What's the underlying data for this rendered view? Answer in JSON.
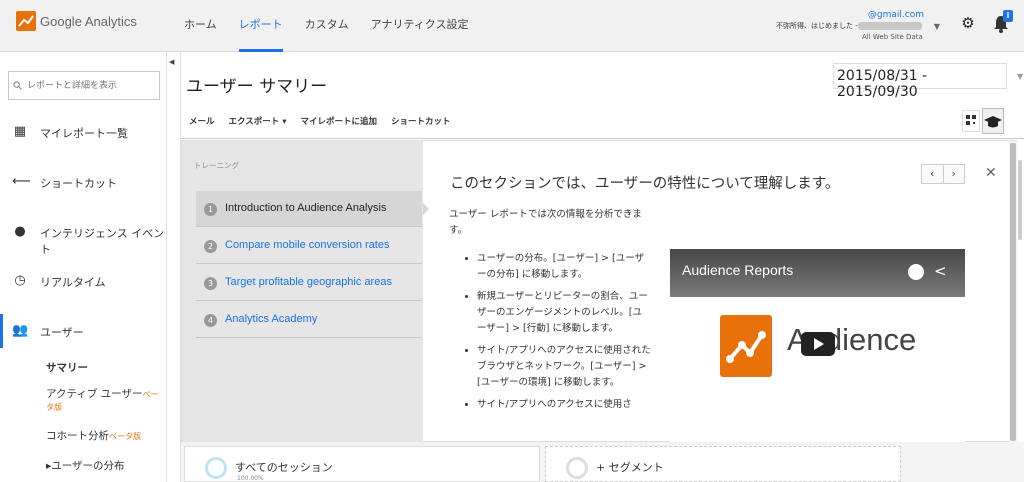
{
  "header": {
    "logo_text": "Google Analytics",
    "nav": [
      "ホーム",
      "レポート",
      "カスタム",
      "アナリティクス設定"
    ],
    "nav_active_index": 1,
    "account": {
      "email_suffix": "@gmail.com",
      "greeting": "不awaiting、はじめました -",
      "property": "All Web Site Data"
    },
    "notification_badge": "i",
    "accent_color": "#1a73e8"
  },
  "sidebar": {
    "search_placeholder": "レポートと詳細を表示",
    "items": [
      {
        "label": "マイレポート一覧",
        "icon": "grid-icon"
      },
      {
        "label": "ショートカット",
        "icon": "shortcut-arrow-icon"
      },
      {
        "label": "インテリジェンス イベント",
        "icon": "lightbulb-icon"
      },
      {
        "label": "リアルタイム",
        "icon": "clock-icon"
      },
      {
        "label": "ユーザー",
        "icon": "users-icon"
      }
    ],
    "sub_items": [
      {
        "label": "サマリー",
        "beta": ""
      },
      {
        "label": "アクティブ ユーザー",
        "beta": "ベータ版"
      },
      {
        "label": "コホート分析",
        "beta": "ベータ版"
      },
      {
        "label": "▸ユーザーの分布",
        "beta": ""
      }
    ]
  },
  "main": {
    "title": "ユーザー サマリー",
    "date_range": "2015/08/31 - 2015/09/30",
    "toolbar": [
      "メール",
      "エクスポート ▾",
      "マイレポートに追加",
      "ショートカット"
    ]
  },
  "training": {
    "label": "トレーニング",
    "lessons": [
      {
        "num": "1",
        "label": "Introduction to Audience Analysis"
      },
      {
        "num": "2",
        "label": "Compare mobile conversion rates"
      },
      {
        "num": "3",
        "label": "Target profitable geographic areas"
      },
      {
        "num": "4",
        "label": "Analytics Academy"
      }
    ],
    "heading": "このセクションでは、ユーザーの特性について理解します。",
    "intro": "ユーザー レポートでは次の情報を分析できます。",
    "bullets": [
      "ユーザーの分布。[ユーザー] > [ユーザーの分布] に移動します。",
      "新規ユーザーとリピーターの割合、ユーザーのエンゲージメントのレベル。[ユーザー] > [行動] に移動します。",
      "サイト/アプリへのアクセスに使用されたブラウザとネットワーク。[ユーザー] > [ユーザーの環境] に移動します。",
      "サイト/アプリへのアクセスに使用さ"
    ],
    "video": {
      "title": "Audience Reports",
      "word": "Audience"
    }
  },
  "segments": [
    {
      "label": "すべてのセッション",
      "sub": "100.00%"
    },
    {
      "label": "+ セグメント",
      "sub": ""
    }
  ]
}
